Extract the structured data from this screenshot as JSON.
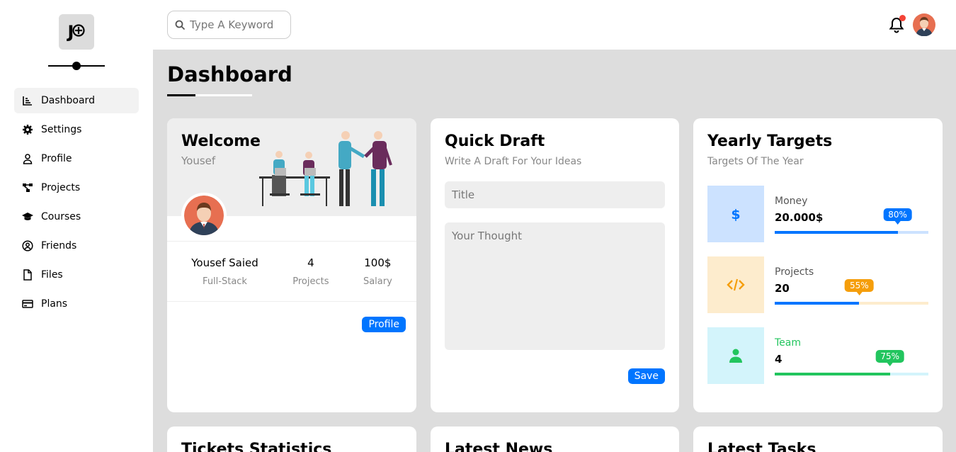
{
  "sidebar": {
    "logo_text": "J",
    "items": [
      {
        "label": "Dashboard",
        "icon": "chart-icon"
      },
      {
        "label": "Settings",
        "icon": "gear-icon"
      },
      {
        "label": "Profile",
        "icon": "user-icon"
      },
      {
        "label": "Projects",
        "icon": "diagram-icon"
      },
      {
        "label": "Courses",
        "icon": "graduation-cap-icon"
      },
      {
        "label": "Friends",
        "icon": "user-circle-icon"
      },
      {
        "label": "Files",
        "icon": "file-icon"
      },
      {
        "label": "Plans",
        "icon": "credit-card-icon"
      }
    ]
  },
  "header": {
    "search_placeholder": "Type A Keyword"
  },
  "page": {
    "title": "Dashboard"
  },
  "welcome": {
    "title": "Welcome",
    "username": "Yousef",
    "stats": [
      {
        "value": "Yousef Saied",
        "label": "Full-Stack"
      },
      {
        "value": "4",
        "label": "Projects"
      },
      {
        "value": "100$",
        "label": "Salary"
      }
    ],
    "button_label": "Profile"
  },
  "draft": {
    "title": "Quick Draft",
    "subtitle": "Write A Draft For Your Ideas",
    "title_placeholder": "Title",
    "thought_placeholder": "Your Thought",
    "button_label": "Save"
  },
  "targets": {
    "title": "Yearly Targets",
    "subtitle": "Targets Of The Year",
    "items": [
      {
        "name": "Money",
        "amount": "20.000$",
        "percent": 80,
        "percent_label": "80%",
        "color": "#0075ff",
        "icon_bg": "#cce2ff",
        "bar_color": "#0075ff",
        "track_color": "#cce2ff",
        "name_color": "#555555"
      },
      {
        "name": "Projects",
        "amount": "20",
        "percent": 55,
        "percent_label": "55%",
        "color": "#f59e0b",
        "icon_bg": "#fdeccd",
        "bar_color": "#0075ff",
        "track_color": "#fdeccd",
        "name_color": "#555555"
      },
      {
        "name": "Team",
        "amount": "4",
        "percent": 75,
        "percent_label": "75%",
        "color": "#22c55e",
        "icon_bg": "#d3f4fb",
        "bar_color": "#22c55e",
        "track_color": "#d3f4fb",
        "name_color": "#22c55e"
      }
    ]
  },
  "bottom_cards": {
    "tickets": "Tickets Statistics",
    "news": "Latest News",
    "tasks": "Latest Tasks"
  }
}
